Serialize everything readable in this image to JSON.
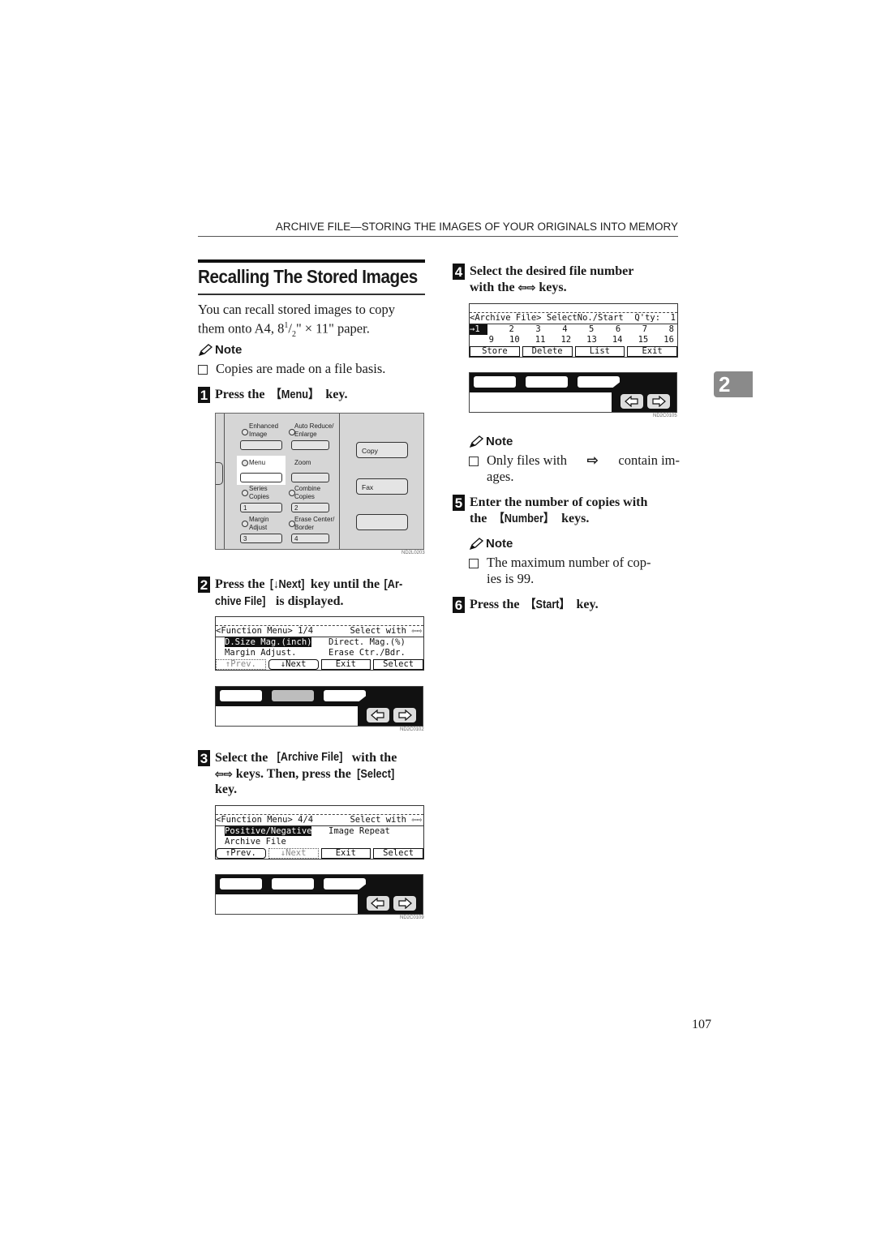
{
  "running_header": "ARCHIVE FILE—STORING THE IMAGES OF YOUR ORIGINALS INTO MEMORY",
  "title": "Recalling The Stored Images",
  "intro": {
    "line1": "You can recall stored images to copy",
    "line2_prefix": "them onto A4, 8",
    "frac_num": "1",
    "frac_sep": "/",
    "frac_den": "2",
    "line2_suffix": "\" × 11\" paper."
  },
  "note1": {
    "label": "Note",
    "items": [
      "Copies are made on a file basis."
    ]
  },
  "steps": [
    {
      "num": "1",
      "pre": "Press the ",
      "key": "【Menu】",
      "post": " key."
    },
    {
      "num": "2",
      "pre": "Press the ",
      "key": "[↓Next]",
      "mid": " key until the ",
      "key2": "[Ar-",
      "line2_key": "chive File]",
      "post": " is displayed."
    },
    {
      "num": "3",
      "pre": "Select the ",
      "key": "[Archive File]",
      "mid": " with the",
      "line2_pre": " keys. Then, press the ",
      "line2_key": "[Select]",
      "line3": "key."
    },
    {
      "num": "4",
      "line1": "Select the desired file number",
      "line2_pre": "with the ",
      "line2_post": " keys."
    },
    {
      "num": "5",
      "line1": "Enter the number of copies with",
      "line2_pre": "the ",
      "key": "【Number】",
      "post": " keys."
    },
    {
      "num": "6",
      "pre": "Press the ",
      "key": "【Start】",
      "post": " key."
    }
  ],
  "note2": {
    "label": "Note",
    "pre": "Only files with ",
    "post": " contain im-",
    "line2": "ages."
  },
  "note3": {
    "label": "Note",
    "line1": "The maximum number of cop-",
    "line2": "ies is 99."
  },
  "operation_panel": {
    "buttons": [
      {
        "label1": "Enhanced",
        "label2": "Image",
        "key": ""
      },
      {
        "label1": "Auto Reduce/",
        "label2": "Enlarge",
        "key": ""
      },
      {
        "label1": "Menu",
        "label2": "",
        "key": ""
      },
      {
        "label1": "Zoom",
        "label2": "",
        "key": ""
      },
      {
        "label1": "Series",
        "label2": "Copies",
        "key": "1"
      },
      {
        "label1": "Combine",
        "label2": "Copies",
        "key": "2"
      },
      {
        "label1": "Margin",
        "label2": "Adjust",
        "key": "3"
      },
      {
        "label1": "Erase Center/",
        "label2": "Border",
        "key": "4"
      }
    ],
    "side_buttons": [
      "Copy",
      "Fax",
      ""
    ],
    "fig_id": "ND2L0203"
  },
  "screen1": {
    "header_left": "<Function Menu> 1/4",
    "header_right": "Select with",
    "rows": [
      {
        "left": "D.Size Mag.(inch)",
        "right": "Direct. Mag.(%)"
      },
      {
        "left": "Margin Adjust.",
        "right": "Erase Ctr./Bdr."
      }
    ],
    "buttons": [
      "↑Prev.",
      "↓Next",
      "Exit",
      "Select"
    ],
    "fig_id": "ND2C0102"
  },
  "screen2": {
    "header_left": "<Function Menu> 4/4",
    "header_right": "Select with",
    "rows": [
      {
        "left": "Positive/Negative",
        "right": "Image Repeat"
      },
      {
        "left": "Archive File",
        "right": ""
      }
    ],
    "buttons": [
      "↑Prev.",
      "↓Next",
      "Exit",
      "Select"
    ],
    "fig_id": "ND2C0109"
  },
  "screen3": {
    "header_left": "<Archive File> SelectNo./Start",
    "header_right": "Q'ty:  1",
    "files_row1": [
      "1",
      "2",
      "3",
      "4",
      "5",
      "6",
      "7",
      "8"
    ],
    "files_row2": [
      "9",
      "10",
      "11",
      "12",
      "13",
      "14",
      "15",
      "16"
    ],
    "buttons": [
      "Store",
      "Delete",
      "List",
      "Exit"
    ],
    "fig_id": "ND2C0105"
  },
  "chapter_tab": "2",
  "page_number": "107"
}
